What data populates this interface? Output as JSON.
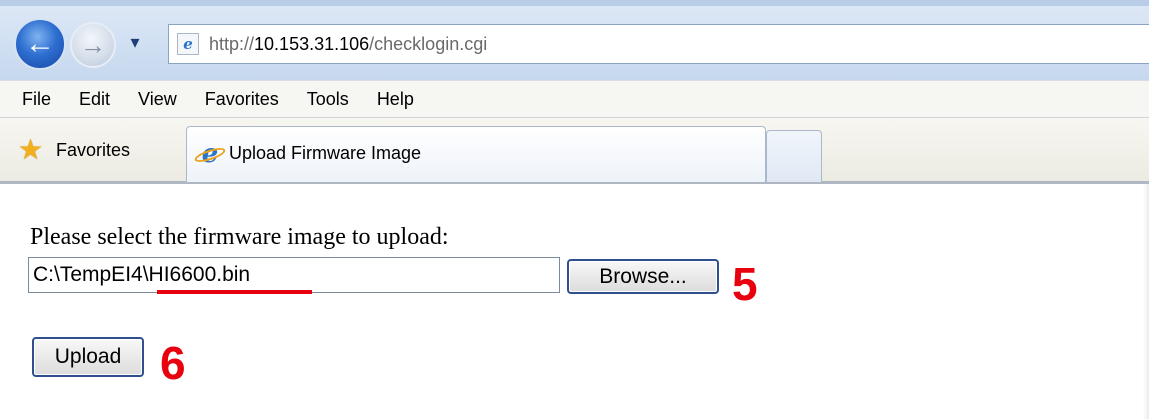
{
  "browser": {
    "address": {
      "scheme": "http://",
      "host": "10.153.31.106",
      "path": "/checklogin.cgi"
    },
    "nav_icons": {
      "back": "back-arrow-icon",
      "forward": "forward-arrow-icon",
      "history": "chevron-down-icon"
    },
    "menu": [
      "File",
      "Edit",
      "View",
      "Favorites",
      "Tools",
      "Help"
    ],
    "favorites_label": "Favorites",
    "tabs": [
      {
        "title": "Upload Firmware Image",
        "icon": "ie-icon",
        "active": true
      }
    ]
  },
  "page": {
    "prompt": "Please select the firmware image to upload:",
    "file_value": "C:\\TempEI4\\HI6600.bin",
    "browse_label": "Browse...",
    "upload_label": "Upload"
  },
  "annotations": {
    "step5": "5",
    "step6": "6",
    "accent_color": "#e8000e"
  }
}
